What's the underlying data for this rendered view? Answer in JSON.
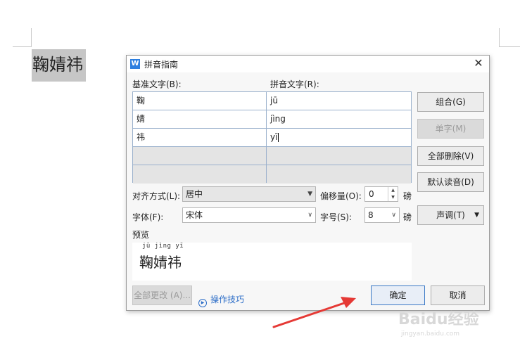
{
  "document": {
    "selected_text": "鞠婧祎"
  },
  "dialog": {
    "title": "拼音指南",
    "close_glyph": "✕",
    "base_text_label": "基准文字(B):",
    "pinyin_text_label": "拼音文字(R):",
    "rows": [
      {
        "base": "鞠",
        "pinyin": "jū"
      },
      {
        "base": "婧",
        "pinyin": "jìng"
      },
      {
        "base": "祎",
        "pinyin": "yī"
      },
      {
        "base": "",
        "pinyin": ""
      },
      {
        "base": "",
        "pinyin": ""
      }
    ],
    "buttons": {
      "combine": "组合(G)",
      "single": "单字(M)",
      "delete_all": "全部删除(V)",
      "default_reading": "默认读音(D)",
      "tone": "声调(T)",
      "change_all": "全部更改 (A)...",
      "ok": "确定",
      "cancel": "取消"
    },
    "alignment": {
      "label": "对齐方式(L):",
      "value": "居中"
    },
    "offset": {
      "label": "偏移量(O):",
      "value": "0",
      "unit": "磅"
    },
    "font": {
      "label": "字体(F):",
      "value": "宋体"
    },
    "size": {
      "label": "字号(S):",
      "value": "8",
      "unit": "磅"
    },
    "preview": {
      "label": "预览",
      "ruby": "jū jìng yī",
      "base": "鞠婧祎"
    },
    "tips_link": "操作技巧"
  },
  "watermark": {
    "text": "Baidu经验",
    "sub": "jingyan.baidu.com"
  },
  "colors": {
    "accent": "#2d6ec8",
    "arrow": "#e53935"
  }
}
